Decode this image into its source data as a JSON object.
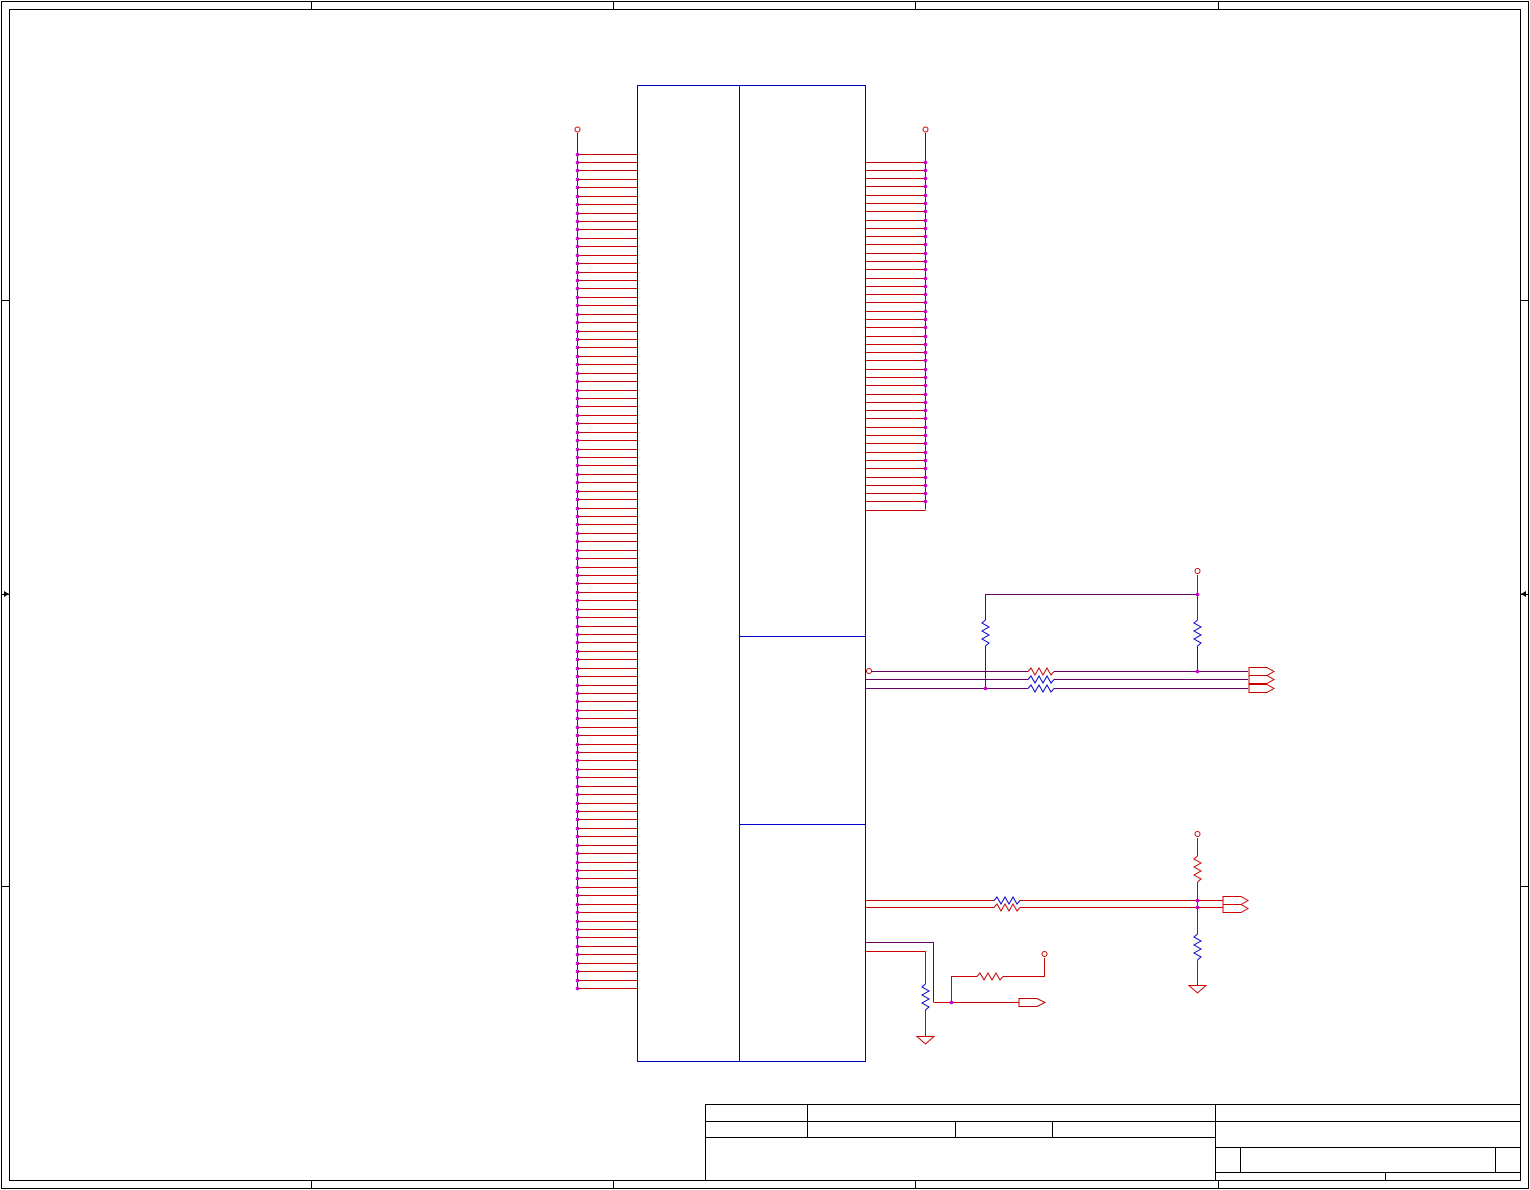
{
  "sheet": {
    "colors": {
      "frame": "#000000",
      "body": "#0000cc",
      "wire": "#cc0000",
      "net": "#660066",
      "junction": "#cc00cc"
    }
  },
  "ic": {
    "left_pin_count": 100,
    "right_upper_pin_count": 43
  },
  "symbols": {
    "power_icon": "circle-terminal",
    "ground_icon": "triangle-ground",
    "offpage_icon": "arrow-connector",
    "resistor_icon": "zigzag-resistor"
  }
}
